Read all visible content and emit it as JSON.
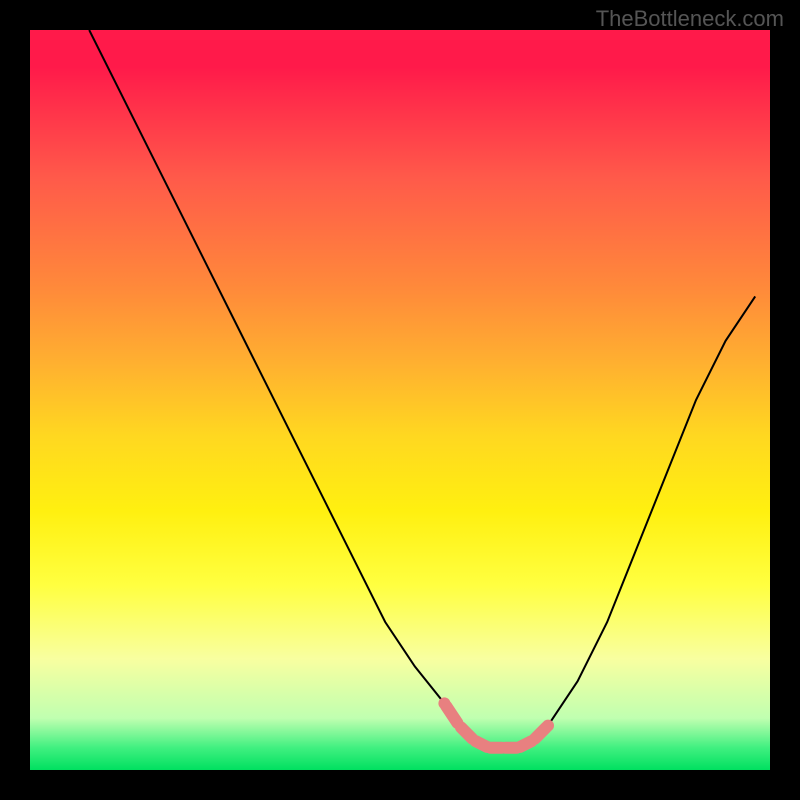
{
  "watermark": "TheBottleneck.com",
  "chart_data": {
    "type": "line",
    "title": "",
    "xlabel": "",
    "ylabel": "",
    "xlim": [
      0,
      100
    ],
    "ylim": [
      0,
      100
    ],
    "series": [
      {
        "name": "bottleneck-curve",
        "x": [
          8,
          12,
          16,
          20,
          24,
          28,
          32,
          36,
          40,
          44,
          48,
          52,
          56,
          58,
          60,
          62,
          64,
          66,
          68,
          70,
          74,
          78,
          82,
          86,
          90,
          94,
          98
        ],
        "values": [
          100,
          92,
          84,
          76,
          68,
          60,
          52,
          44,
          36,
          28,
          20,
          14,
          9,
          6,
          4,
          3,
          3,
          3,
          4,
          6,
          12,
          20,
          30,
          40,
          50,
          58,
          64
        ]
      }
    ],
    "highlight_range_x": [
      56,
      70
    ],
    "annotations": []
  },
  "colors": {
    "background": "#000000",
    "gradient_top": "#ff1a4a",
    "gradient_bottom": "#00e060",
    "curve": "#000000",
    "marker": "#e88080",
    "watermark": "#555555"
  }
}
